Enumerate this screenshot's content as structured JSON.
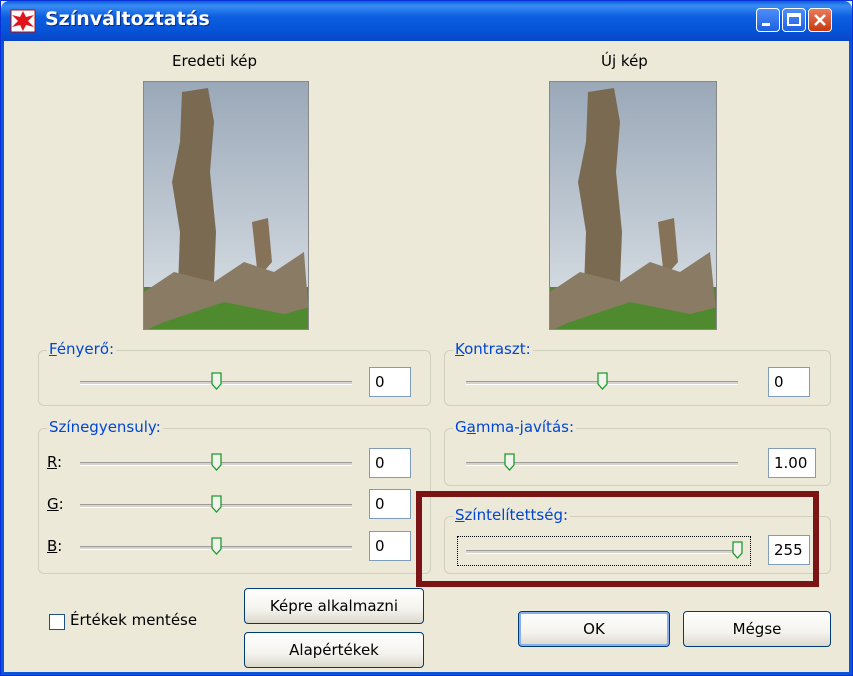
{
  "window": {
    "title": "Színváltoztatás"
  },
  "preview": {
    "original_label": "Eredeti kép",
    "new_label": "Új kép"
  },
  "brightness": {
    "title_hotkey": "F",
    "title_rest": "ényerő:",
    "value": "0",
    "position": 0.5
  },
  "contrast": {
    "title_hotkey": "K",
    "title_rest": "ontraszt:",
    "value": "0",
    "position": 0.5
  },
  "color_balance": {
    "title": "Színegyensuly:",
    "channels": [
      {
        "hotkey": "R",
        "suffix": ":",
        "value": "0",
        "position": 0.5
      },
      {
        "hotkey": "G",
        "suffix": ":",
        "value": "0",
        "position": 0.5
      },
      {
        "hotkey": "B",
        "suffix": ":",
        "value": "0",
        "position": 0.5
      }
    ]
  },
  "gamma": {
    "title_pre": "G",
    "title_hotkey": "a",
    "title_rest": "mma-javítás:",
    "value": "1.00",
    "position": 0.15
  },
  "saturation": {
    "title_hotkey": "S",
    "title_rest": "zíntelítettség:",
    "value": "255",
    "position": 1.0
  },
  "save_values": {
    "label": "Értékek mentése",
    "checked": false
  },
  "buttons": {
    "apply": "Képre alkalmazni",
    "defaults": "Alapértékek",
    "ok": "OK",
    "cancel": "Mégse"
  },
  "colors": {
    "title_bar": "#0b5ee0",
    "group_title": "#0046d5",
    "highlight_box": "#7b1414",
    "dialog_bg": "#ece9d8"
  },
  "icons": [
    "app-icon",
    "minimize-icon",
    "maximize-icon",
    "close-icon",
    "slider-thumb-icon"
  ]
}
